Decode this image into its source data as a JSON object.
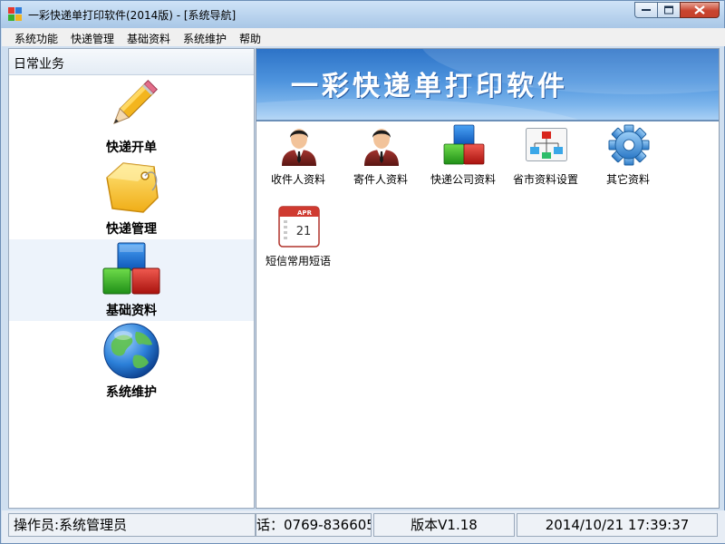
{
  "window": {
    "title": "一彩快递单打印软件(2014版) - [系统导航]"
  },
  "menu": [
    "系统功能",
    "快递管理",
    "基础资料",
    "系统维护",
    "帮助"
  ],
  "left_panel": {
    "header": "日常业务",
    "items": [
      {
        "label": "快递开单",
        "icon": "pencil-icon"
      },
      {
        "label": "快递管理",
        "icon": "tag-icon"
      },
      {
        "label": "基础资料",
        "icon": "blocks-icon"
      },
      {
        "label": "系统维护",
        "icon": "globe-icon"
      }
    ],
    "active_index": 2
  },
  "banner": {
    "title": "一彩快递单打印软件"
  },
  "tiles": [
    {
      "label": "收件人资料",
      "icon": "user-icon"
    },
    {
      "label": "寄件人资料",
      "icon": "user-icon"
    },
    {
      "label": "快递公司资料",
      "icon": "blocks-icon"
    },
    {
      "label": "省市资料设置",
      "icon": "org-chart-icon"
    },
    {
      "label": "其它资料",
      "icon": "gear-icon"
    },
    {
      "label": "短信常用短语",
      "icon": "calendar-icon",
      "calendar_month": "APR",
      "calendar_day": "21"
    }
  ],
  "status": {
    "operator": "操作员:系统管理员",
    "phone": "话：0769-836605",
    "version": "版本V1.18",
    "datetime": "2014/10/21 17:39:37"
  },
  "colors": {
    "banner_top": "#2d73c7",
    "banner_bottom": "#a9d0f5",
    "active_nav_bg": "#edf3fb",
    "close_button": "#c9442f"
  }
}
